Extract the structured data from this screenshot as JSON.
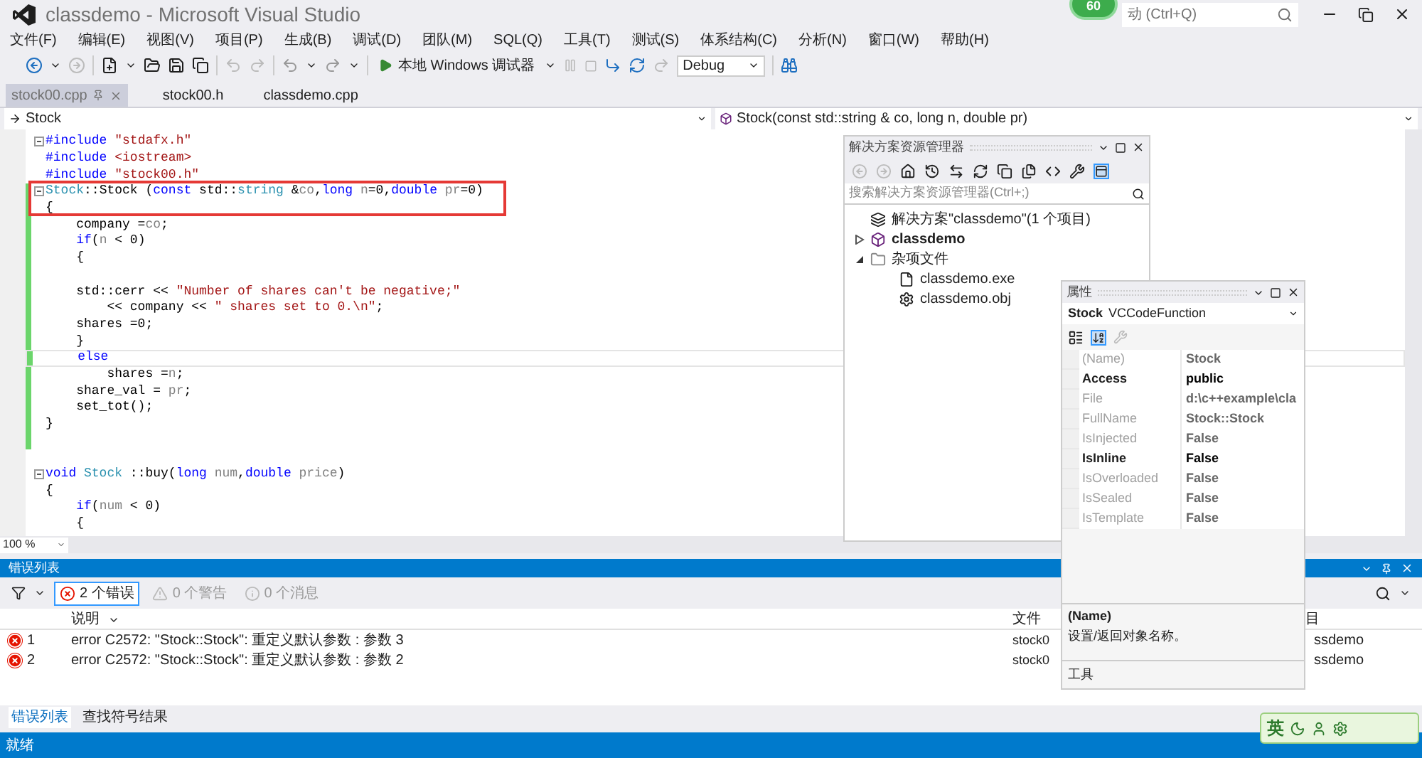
{
  "window": {
    "title": "classdemo - Microsoft Visual Studio",
    "badge": "60",
    "quick_launch": "动 (Ctrl+Q)"
  },
  "menu": [
    "文件(F)",
    "编辑(E)",
    "视图(V)",
    "项目(P)",
    "生成(B)",
    "调试(D)",
    "团队(M)",
    "SQL(Q)",
    "工具(T)",
    "测试(S)",
    "体系结构(C)",
    "分析(N)",
    "窗口(W)",
    "帮助(H)"
  ],
  "toolbar": {
    "debugger": "本地 Windows 调试器",
    "configuration": "Debug"
  },
  "tabs": [
    {
      "label": "stock00.cpp",
      "selected": true
    },
    {
      "label": "stock00.h",
      "selected": false
    },
    {
      "label": "classdemo.cpp",
      "selected": false
    }
  ],
  "nav": {
    "scope": "Stock",
    "member": "Stock(const std::string & co, long n, double pr)"
  },
  "code_lines": [
    {
      "fold": true,
      "changed": false,
      "tokens": [
        {
          "text": "#include",
          "kind": "kw"
        },
        {
          "text": " \"stdafx.h\"",
          "kind": "str"
        }
      ]
    },
    {
      "fold": false,
      "changed": false,
      "tokens": [
        {
          "text": "#include",
          "kind": "kw"
        },
        {
          "text": " <iostream>",
          "kind": "str"
        }
      ]
    },
    {
      "fold": false,
      "changed": false,
      "tokens": [
        {
          "text": "#include",
          "kind": "kw"
        },
        {
          "text": " \"stock00.h\"",
          "kind": "str"
        }
      ]
    },
    {
      "fold": true,
      "changed": true,
      "tokens": [
        {
          "text": "Stock",
          "kind": "type"
        },
        {
          "text": "::Stock (",
          "kind": "plain"
        },
        {
          "text": "const",
          "kind": "kw"
        },
        {
          "text": " std::",
          "kind": "plain"
        },
        {
          "text": "string",
          "kind": "type"
        },
        {
          "text": " &",
          "kind": "plain"
        },
        {
          "text": "co",
          "kind": "param"
        },
        {
          "text": ",",
          "kind": "plain"
        },
        {
          "text": "long",
          "kind": "kw"
        },
        {
          "text": " n",
          "kind": "param"
        },
        {
          "text": "=0,",
          "kind": "plain"
        },
        {
          "text": "double",
          "kind": "kw"
        },
        {
          "text": " pr",
          "kind": "param"
        },
        {
          "text": "=0)",
          "kind": "plain"
        }
      ]
    },
    {
      "fold": false,
      "changed": true,
      "tokens": [
        {
          "text": "{",
          "kind": "plain"
        }
      ]
    },
    {
      "fold": false,
      "changed": true,
      "tokens": [
        {
          "text": "    company =",
          "kind": "plain"
        },
        {
          "text": "co",
          "kind": "param"
        },
        {
          "text": ";",
          "kind": "plain"
        }
      ]
    },
    {
      "fold": false,
      "changed": true,
      "tokens": [
        {
          "text": "    if",
          "kind": "kw"
        },
        {
          "text": "(",
          "kind": "plain"
        },
        {
          "text": "n",
          "kind": "param"
        },
        {
          "text": " < 0)",
          "kind": "plain"
        }
      ]
    },
    {
      "fold": false,
      "changed": true,
      "tokens": [
        {
          "text": "    {",
          "kind": "plain"
        }
      ]
    },
    {
      "fold": false,
      "changed": true
    },
    {
      "fold": false,
      "changed": true,
      "tokens": [
        {
          "text": "    std::cerr << ",
          "kind": "plain"
        },
        {
          "text": "\"Number of shares can't be negative;\"",
          "kind": "str"
        }
      ]
    },
    {
      "fold": false,
      "changed": true,
      "tokens": [
        {
          "text": "        << company << ",
          "kind": "plain"
        },
        {
          "text": "\" shares set to 0.\\n\"",
          "kind": "str"
        },
        {
          "text": ";",
          "kind": "plain"
        }
      ]
    },
    {
      "fold": false,
      "changed": true,
      "tokens": [
        {
          "text": "    shares =0;",
          "kind": "plain"
        }
      ]
    },
    {
      "fold": false,
      "changed": true,
      "tokens": [
        {
          "text": "    }",
          "kind": "plain"
        }
      ]
    },
    {
      "fold": false,
      "changed": true,
      "current": true,
      "tokens": [
        {
          "text": "    else",
          "kind": "kw"
        }
      ]
    },
    {
      "fold": false,
      "changed": true,
      "tokens": [
        {
          "text": "        shares =",
          "kind": "plain"
        },
        {
          "text": "n",
          "kind": "param"
        },
        {
          "text": ";",
          "kind": "plain"
        }
      ]
    },
    {
      "fold": false,
      "changed": true,
      "tokens": [
        {
          "text": "    share_val = ",
          "kind": "plain"
        },
        {
          "text": "pr",
          "kind": "param"
        },
        {
          "text": ";",
          "kind": "plain"
        }
      ]
    },
    {
      "fold": false,
      "changed": true,
      "tokens": [
        {
          "text": "    set_tot();",
          "kind": "plain"
        }
      ]
    },
    {
      "fold": false,
      "changed": true,
      "tokens": [
        {
          "text": "}",
          "kind": "plain"
        }
      ]
    },
    {
      "fold": false,
      "changed": true
    },
    {
      "fold": false,
      "changed": false
    },
    {
      "fold": true,
      "changed": false,
      "tokens": [
        {
          "text": "void",
          "kind": "kw"
        },
        {
          "text": " Stock",
          "kind": "type"
        },
        {
          "text": " ::buy(",
          "kind": "plain"
        },
        {
          "text": "long",
          "kind": "kw"
        },
        {
          "text": " num",
          "kind": "param"
        },
        {
          "text": ",",
          "kind": "plain"
        },
        {
          "text": "double",
          "kind": "kw"
        },
        {
          "text": " price",
          "kind": "param"
        },
        {
          "text": ")",
          "kind": "plain"
        }
      ]
    },
    {
      "fold": false,
      "changed": false,
      "tokens": [
        {
          "text": "{",
          "kind": "plain"
        }
      ]
    },
    {
      "fold": false,
      "changed": false,
      "tokens": [
        {
          "text": "    if",
          "kind": "kw"
        },
        {
          "text": "(",
          "kind": "plain"
        },
        {
          "text": "num",
          "kind": "param"
        },
        {
          "text": " < 0)",
          "kind": "plain"
        }
      ]
    },
    {
      "fold": false,
      "changed": false,
      "tokens": [
        {
          "text": "    {",
          "kind": "plain"
        }
      ]
    }
  ],
  "zoom": "100 %",
  "solution_explorer": {
    "title": "解决方案资源管理器",
    "search_placeholder": "搜索解决方案资源管理器(Ctrl+;)",
    "tree": [
      {
        "label": "解决方案\"classdemo\"(1 个项目)",
        "kind": "solution"
      },
      {
        "label": "classdemo",
        "kind": "project",
        "expanded": false
      },
      {
        "label": "杂项文件",
        "kind": "folder",
        "expanded": true,
        "children": [
          {
            "label": "classdemo.exe",
            "kind": "file"
          },
          {
            "label": "classdemo.obj",
            "kind": "object"
          }
        ]
      }
    ]
  },
  "properties": {
    "title": "属性",
    "object": "Stock",
    "type": "VCCodeFunction",
    "rows": [
      {
        "name": "(Name)",
        "value": "Stock",
        "disabled": true
      },
      {
        "name": "Access",
        "value": "public",
        "disabled": false
      },
      {
        "name": "File",
        "value": "d:\\c++example\\cla",
        "disabled": true
      },
      {
        "name": "FullName",
        "value": "Stock::Stock",
        "disabled": true
      },
      {
        "name": "IsInjected",
        "value": "False",
        "disabled": true
      },
      {
        "name": "IsInline",
        "value": "False",
        "disabled": false
      },
      {
        "name": "IsOverloaded",
        "value": "False",
        "disabled": true
      },
      {
        "name": "IsSealed",
        "value": "False",
        "disabled": true
      },
      {
        "name": "IsTemplate",
        "value": "False",
        "disabled": true
      }
    ],
    "description_title": "(Name)",
    "description": "设置/返回对象名称。",
    "footer": "工具"
  },
  "error_list": {
    "title": "错误列表",
    "filters": [
      {
        "kind": "errors",
        "label": "2 个错误",
        "selected": true
      },
      {
        "kind": "warnings",
        "label": "0 个警告",
        "selected": false
      },
      {
        "kind": "messages",
        "label": "0 个消息",
        "selected": false
      }
    ],
    "columns": [
      "说明",
      "文件",
      "目"
    ],
    "rows": [
      {
        "index": "1",
        "description": "error C2572: \"Stock::Stock\": 重定义默认参数 : 参数 3",
        "file": "stock0",
        "project": "ssdemo"
      },
      {
        "index": "2",
        "description": "error C2572: \"Stock::Stock\": 重定义默认参数 : 参数 2",
        "file": "stock0",
        "project": "ssdemo"
      }
    ],
    "bottom_tabs": [
      {
        "label": "错误列表",
        "selected": true
      },
      {
        "label": "查找符号结果",
        "selected": false
      }
    ]
  },
  "status_bar": "就绪",
  "ime": {
    "label": "英"
  }
}
